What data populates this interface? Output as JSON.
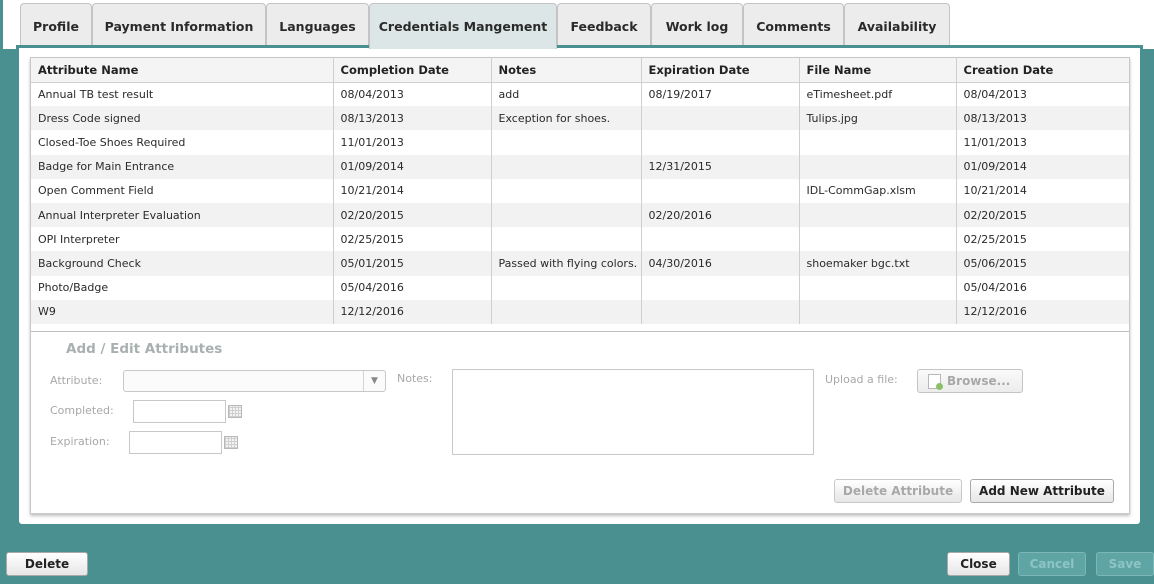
{
  "tabs": [
    {
      "label": "Profile"
    },
    {
      "label": "Payment Information"
    },
    {
      "label": "Languages"
    },
    {
      "label": "Credentials Mangement"
    },
    {
      "label": "Feedback"
    },
    {
      "label": "Work log"
    },
    {
      "label": "Comments"
    },
    {
      "label": "Availability"
    }
  ],
  "active_tab": "Credentials Mangement",
  "grid": {
    "columns": [
      "Attribute Name",
      "Completion Date",
      "Notes",
      "Expiration Date",
      "File Name",
      "Creation Date"
    ],
    "rows": [
      [
        "Annual TB test result",
        "08/04/2013",
        "add",
        "08/19/2017",
        "eTimesheet.pdf",
        "08/04/2013"
      ],
      [
        "Dress Code signed",
        "08/13/2013",
        "Exception for shoes.",
        "",
        "Tulips.jpg",
        "08/13/2013"
      ],
      [
        "Closed-Toe Shoes Required",
        "11/01/2013",
        "",
        "",
        "",
        "11/01/2013"
      ],
      [
        "Badge for Main Entrance",
        "01/09/2014",
        "",
        "12/31/2015",
        "",
        "01/09/2014"
      ],
      [
        "Open Comment Field",
        "10/21/2014",
        "",
        "",
        "IDL-CommGap.xlsm",
        "10/21/2014"
      ],
      [
        "Annual Interpreter Evaluation",
        "02/20/2015",
        "",
        "02/20/2016",
        "",
        "02/20/2015"
      ],
      [
        "OPI Interpreter",
        "02/25/2015",
        "",
        "",
        "",
        "02/25/2015"
      ],
      [
        "Background Check",
        "05/01/2015",
        "Passed with flying colors.",
        "04/30/2016",
        "shoemaker bgc.txt",
        "05/06/2015"
      ],
      [
        "Photo/Badge",
        "05/04/2016",
        "",
        "",
        "",
        "05/04/2016"
      ],
      [
        "W9",
        "12/12/2016",
        "",
        "",
        "",
        "12/12/2016"
      ]
    ]
  },
  "form": {
    "title": "Add / Edit Attributes",
    "attribute_label": "Attribute:",
    "attribute_value": "",
    "completed_label": "Completed:",
    "completed_value": "",
    "expiration_label": "Expiration:",
    "expiration_value": "",
    "notes_label": "Notes:",
    "notes_value": "",
    "upload_label": "Upload a file:",
    "browse_label": "Browse..."
  },
  "panel_buttons": {
    "delete_attribute": "Delete Attribute",
    "add_new_attribute": "Add New Attribute"
  },
  "footer": {
    "delete": "Delete",
    "close": "Close",
    "cancel": "Cancel",
    "save": "Save"
  },
  "colors": {
    "teal_frame": "#4a9090",
    "active_tab": "#dde6e6",
    "tab": "#ececec"
  }
}
